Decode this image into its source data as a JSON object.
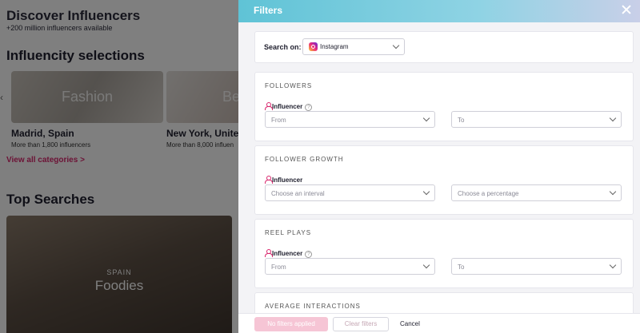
{
  "background": {
    "title": "Discover Influencers",
    "subtitle": "+200 million influencers available",
    "selections_heading": "Influencity selections",
    "cards": [
      {
        "image_word": "Fashion",
        "name": "Madrid, Spain",
        "count": "More than 1,800 influencers"
      },
      {
        "image_word": "Be",
        "name": "New York, United St",
        "count": "More than 8,000 influen"
      }
    ],
    "view_all": "View all categories >",
    "top_searches_heading": "Top Searches",
    "top_search": {
      "country": "SPAIN",
      "label": "Foodies"
    },
    "arrow_glyph": "‹"
  },
  "drawer": {
    "title": "Filters",
    "search_on_label": "Search on:",
    "platform": {
      "value": "Instagram",
      "icon": "instagram-icon"
    },
    "sections": [
      {
        "title": "FOLLOWERS",
        "influencer_label": "Influencer",
        "has_help": true,
        "fields": [
          {
            "placeholder": "From"
          },
          {
            "placeholder": "To"
          }
        ]
      },
      {
        "title": "FOLLOWER GROWTH",
        "influencer_label": "Influencer",
        "has_help": false,
        "fields": [
          {
            "placeholder": "Choose an interval"
          },
          {
            "placeholder": "Choose a percentage"
          }
        ]
      },
      {
        "title": "REEL PLAYS",
        "influencer_label": "Influencer",
        "has_help": true,
        "fields": [
          {
            "placeholder": "From"
          },
          {
            "placeholder": "To"
          }
        ]
      },
      {
        "title": "AVERAGE INTERACTIONS"
      }
    ],
    "help_glyph": "?",
    "footer": {
      "apply_label": "No filters applied",
      "clear_label": "Clear filters",
      "cancel_label": "Cancel"
    }
  },
  "colors": {
    "accent": "#d9266d",
    "header_gradient_start": "#5fc3d6",
    "header_gradient_end": "#c9cfe8",
    "apply_disabled": "#f6c5d5"
  }
}
